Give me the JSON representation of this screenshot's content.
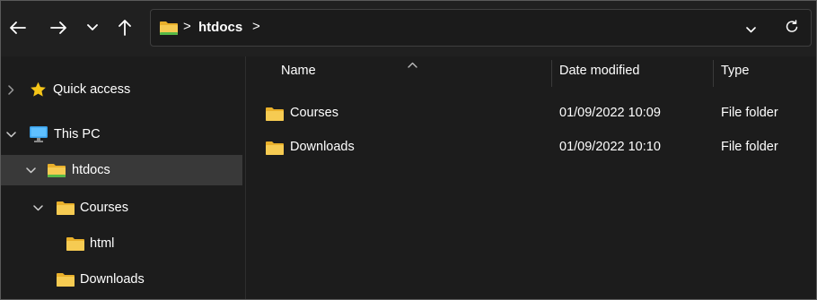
{
  "address_bar": {
    "breadcrumb": [
      "htdocs"
    ],
    "separator": ">"
  },
  "nav_icons": {
    "back": "arrow-left-icon",
    "forward": "arrow-right-icon",
    "recent": "chevron-down-icon",
    "up": "arrow-up-icon",
    "dropdown": "chevron-down-icon",
    "refresh": "refresh-icon"
  },
  "sidebar": {
    "items": [
      {
        "label": "Quick access",
        "icon": "star-icon",
        "expander": "collapsed"
      },
      {
        "label": "This PC",
        "icon": "monitor-icon",
        "expander": "expanded"
      },
      {
        "label": "htdocs",
        "icon": "folder-icon",
        "expander": "expanded",
        "selected": true
      },
      {
        "label": "Courses",
        "icon": "folder-icon",
        "expander": "expanded"
      },
      {
        "label": "html",
        "icon": "folder-icon"
      },
      {
        "label": "Downloads",
        "icon": "folder-icon"
      }
    ]
  },
  "columns": {
    "name": "Name",
    "date": "Date modified",
    "type": "Type"
  },
  "files": [
    {
      "name": "Courses",
      "date": "01/09/2022 10:09",
      "type": "File folder"
    },
    {
      "name": "Downloads",
      "date": "01/09/2022 10:10",
      "type": "File folder"
    }
  ],
  "colors": {
    "folder_yellow": "#f4c542",
    "star": "#f5c518",
    "monitor": "#3aa0e8",
    "selected_row": "#393939"
  }
}
